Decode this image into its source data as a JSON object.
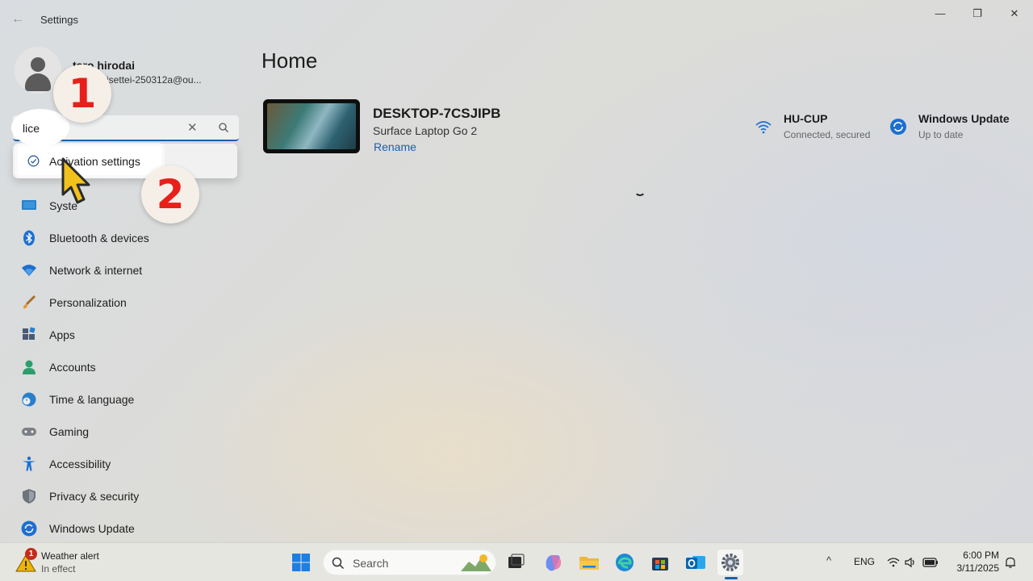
{
  "window": {
    "title": "Settings",
    "back_glyph": "←",
    "minimize_glyph": "—",
    "maximize_glyph": "❐",
    "close_glyph": "✕"
  },
  "profile": {
    "name": "taro hirodai",
    "email": "oc-shokisettei-250312a@ou..."
  },
  "search": {
    "value": "lice",
    "clear_glyph": "✕",
    "suggestion": "Activation settings"
  },
  "nav": {
    "items": [
      {
        "label": "Syste",
        "icon": "system-icon"
      },
      {
        "label": "Bluetooth & devices",
        "icon": "bluetooth-icon"
      },
      {
        "label": "Network & internet",
        "icon": "network-icon"
      },
      {
        "label": "Personalization",
        "icon": "brush-icon"
      },
      {
        "label": "Apps",
        "icon": "apps-icon"
      },
      {
        "label": "Accounts",
        "icon": "accounts-icon"
      },
      {
        "label": "Time & language",
        "icon": "globe-clock-icon"
      },
      {
        "label": "Gaming",
        "icon": "gamepad-icon"
      },
      {
        "label": "Accessibility",
        "icon": "accessibility-icon"
      },
      {
        "label": "Privacy & security",
        "icon": "shield-icon"
      },
      {
        "label": "Windows Update",
        "icon": "update-icon"
      }
    ]
  },
  "main": {
    "title": "Home",
    "device": {
      "name": "DESKTOP-7CSJIPB",
      "model": "Surface Laptop Go 2",
      "rename_label": "Rename"
    },
    "wifi": {
      "title": "HU-CUP",
      "status": "Connected, secured"
    },
    "update": {
      "title": "Windows Update",
      "status": "Up to date"
    }
  },
  "annotations": {
    "step1": "1",
    "step2": "2"
  },
  "taskbar": {
    "weather_title": "Weather alert",
    "weather_sub": "In effect",
    "weather_badge": "1",
    "search_label": "Search",
    "chevron": "^",
    "language": "ENG",
    "time": "6:00 PM",
    "date": "3/11/2025"
  },
  "colors": {
    "accent": "#1d5fa8",
    "annotation_red": "#e8201a"
  }
}
